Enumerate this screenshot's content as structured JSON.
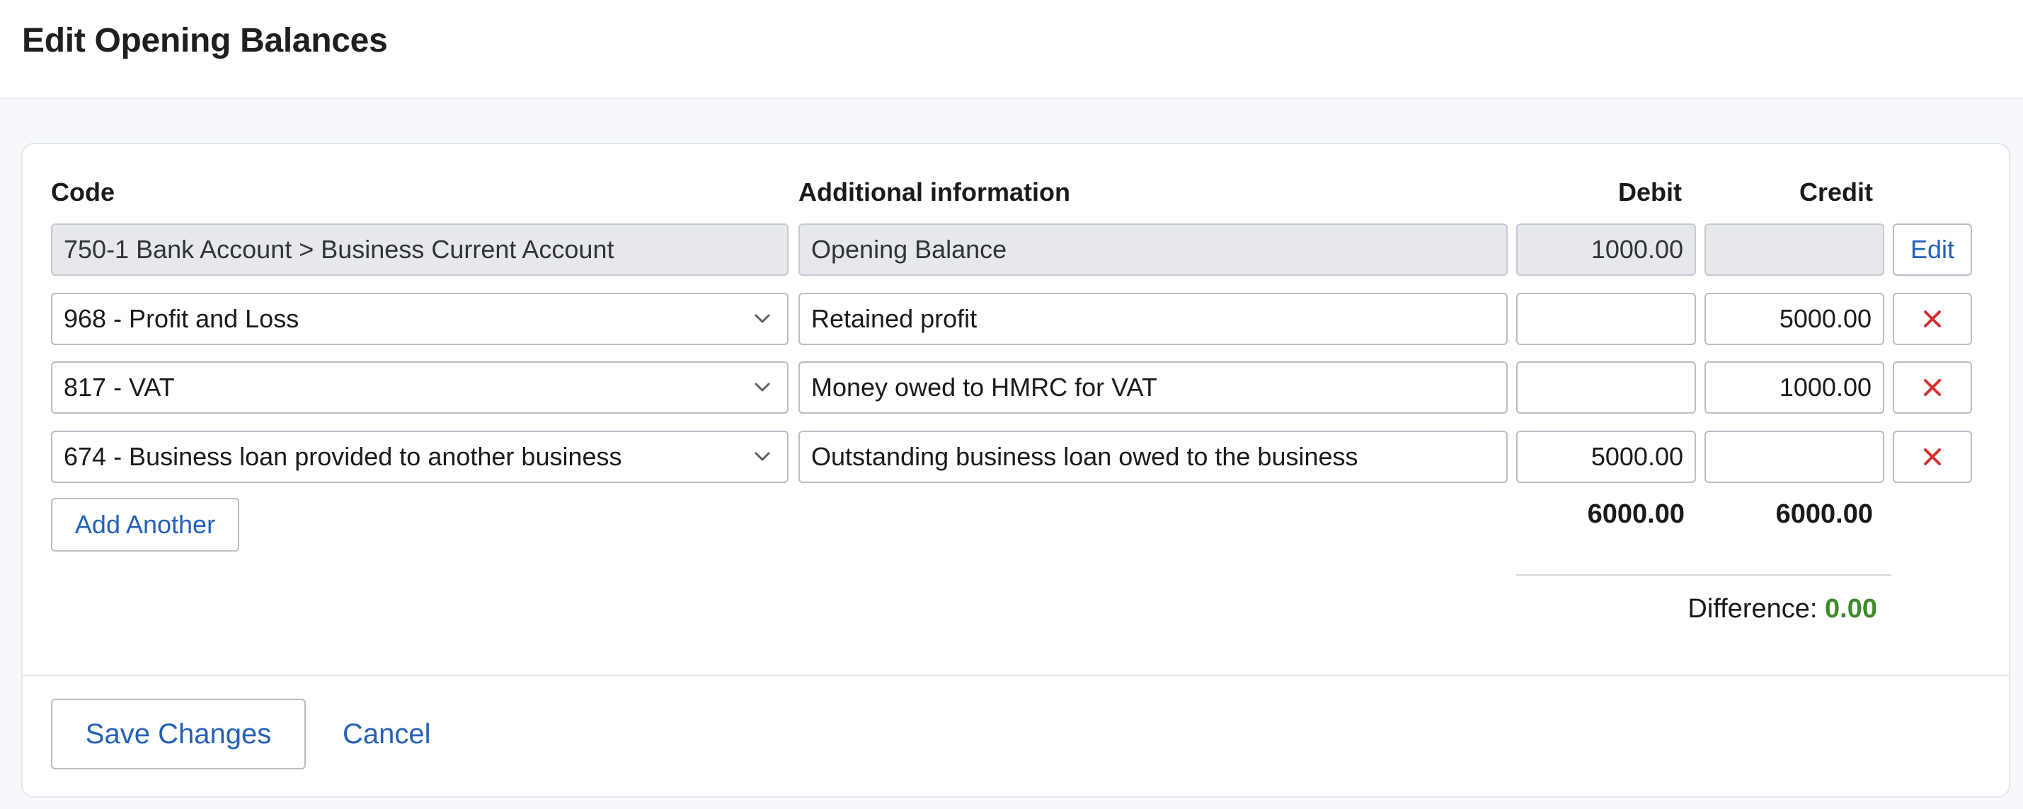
{
  "page": {
    "title": "Edit Opening Balances"
  },
  "table": {
    "headers": {
      "code": "Code",
      "info": "Additional information",
      "debit": "Debit",
      "credit": "Credit"
    },
    "fixed_row": {
      "code": "750-1 Bank Account  >  Business Current Account",
      "info": "Opening Balance",
      "debit": "1000.00",
      "credit": "",
      "action_label": "Edit"
    },
    "rows": [
      {
        "code": "968 - Profit and Loss",
        "info": "Retained profit",
        "debit": "",
        "credit": "5000.00"
      },
      {
        "code": "817 - VAT",
        "info": "Money owed to HMRC for VAT",
        "debit": "",
        "credit": "1000.00"
      },
      {
        "code": "674 - Business loan provided to another business",
        "info": "Outstanding business loan owed to the business",
        "debit": "5000.00",
        "credit": ""
      }
    ],
    "add_label": "Add Another",
    "totals": {
      "debit": "6000.00",
      "credit": "6000.00"
    },
    "difference": {
      "label": "Difference:",
      "value": "0.00"
    }
  },
  "footer": {
    "save_label": "Save Changes",
    "cancel_label": "Cancel"
  },
  "icons": {
    "dropdown": "chevron-down-icon",
    "remove": "close-icon"
  },
  "colors": {
    "link": "#2461b6",
    "danger": "#d32f2f",
    "success": "#3f8a2a"
  }
}
